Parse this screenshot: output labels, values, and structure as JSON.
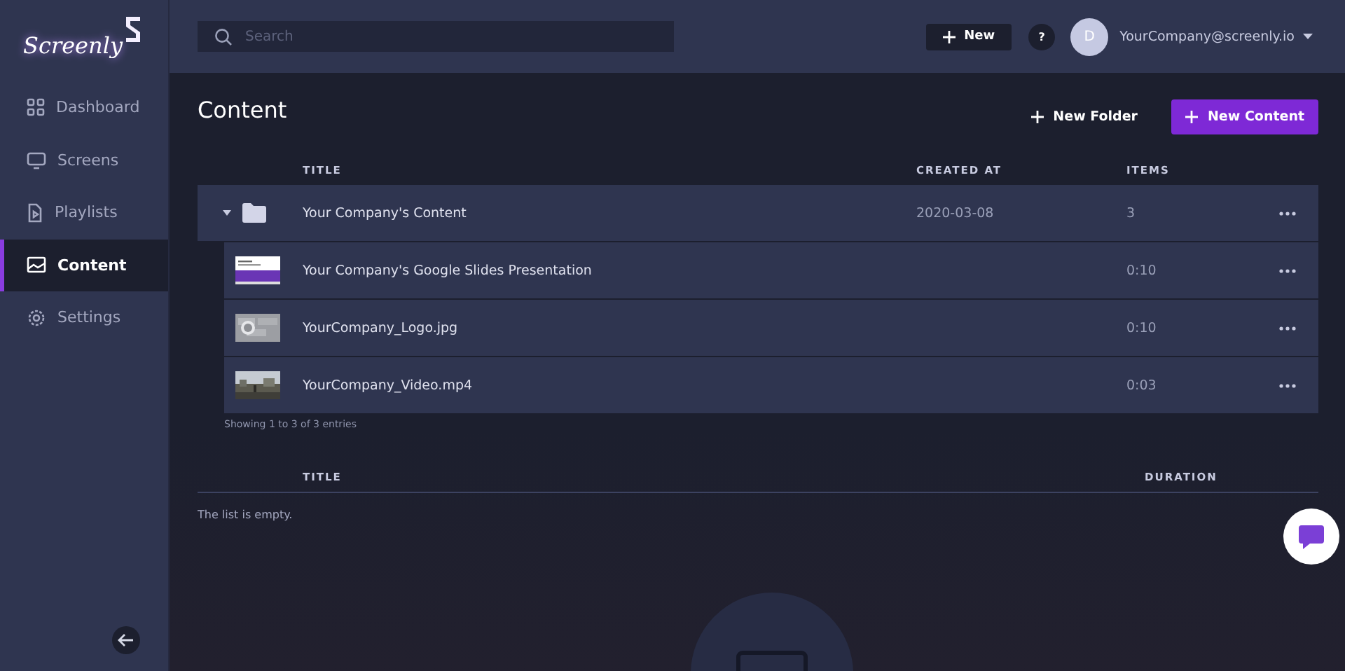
{
  "brand": "Screenly",
  "sidebar": {
    "items": [
      {
        "label": "Dashboard",
        "selected": false
      },
      {
        "label": "Screens",
        "selected": false
      },
      {
        "label": "Playlists",
        "selected": false
      },
      {
        "label": "Content",
        "selected": true
      },
      {
        "label": "Settings",
        "selected": false
      }
    ]
  },
  "topbar": {
    "search": {
      "placeholder": "Search"
    },
    "new_button": "New",
    "help": "?",
    "avatar": "D",
    "account": "YourCompany@screenly.io"
  },
  "page": {
    "title": "Content",
    "new_folder": "New Folder",
    "new_content": "New Content"
  },
  "table": {
    "columns": [
      "TITLE",
      "CREATED AT",
      "ITEMS"
    ],
    "rows": [
      {
        "title": "Your Company's Content",
        "created_at": "2020-03-08",
        "items": "3",
        "expanded": true,
        "children": [
          {
            "title": "Your Company's Google Slides Presentation",
            "duration": "0:10"
          },
          {
            "title": "YourCompany_Logo.jpg",
            "duration": "0:10"
          },
          {
            "title": "YourCompany_Video.mp4",
            "duration": "0:03"
          }
        ]
      }
    ],
    "footer": "Showing 1 to 3 of 3 entries"
  },
  "playlist_table": {
    "columns": [
      "TITLE",
      "DURATION"
    ],
    "empty": "The list is empty."
  }
}
